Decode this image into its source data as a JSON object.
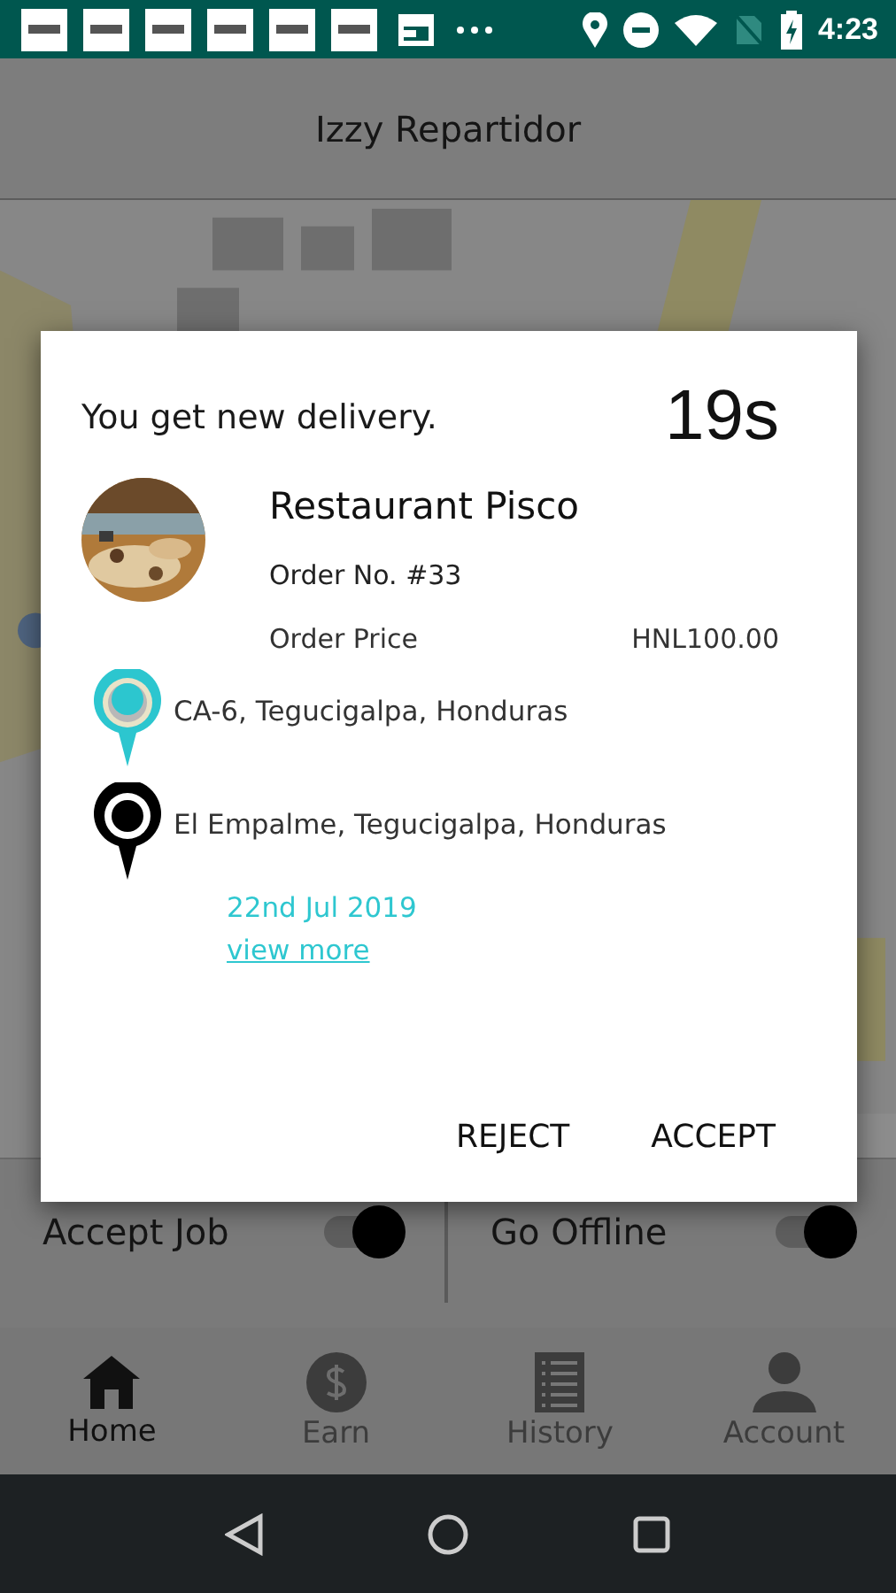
{
  "status_bar": {
    "time": "4:23"
  },
  "app_bar": {
    "title": "Izzy Repartidor"
  },
  "dialog": {
    "message": "You get new delivery.",
    "countdown": "19s",
    "restaurant": "Restaurant Pisco",
    "order_number": "Order No. #33",
    "price_label": "Order Price",
    "price": "HNL100.00",
    "stops": [
      {
        "kind": "pickup",
        "address": "CA-6, Tegucigalpa, Honduras"
      },
      {
        "kind": "dropoff",
        "address": "El Empalme, Tegucigalpa, Honduras"
      }
    ],
    "date": "22nd Jul 2019",
    "link": "view more",
    "buttons": [
      "REJECT",
      "ACCEPT"
    ]
  },
  "toggles": [
    {
      "label": "Accept Job",
      "on": true
    },
    {
      "label": "Go Offline",
      "on": true
    }
  ],
  "tabs": [
    {
      "label": "Home",
      "selected": true
    },
    {
      "label": "Earn",
      "selected": false
    },
    {
      "label": "History",
      "selected": false
    },
    {
      "label": "Account",
      "selected": false
    }
  ]
}
